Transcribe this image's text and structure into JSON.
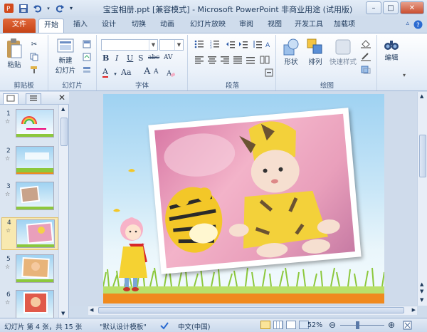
{
  "window": {
    "title": "宝宝相册.ppt [兼容模式] - Microsoft PowerPoint 非商业用途 (试用版)",
    "controls": [
      "–",
      "□",
      "✕"
    ]
  },
  "ribbon_tabs": [
    "文件",
    "开始",
    "插入",
    "设计",
    "切换",
    "动画",
    "幻灯片放映",
    "审阅",
    "视图",
    "开发工具",
    "加载项"
  ],
  "ribbon": {
    "clipboard": {
      "paste_label": "粘贴",
      "group_label": "剪贴板"
    },
    "slides": {
      "new_slide_label_1": "新建",
      "new_slide_label_2": "幻灯片",
      "group_label": "幻灯片"
    },
    "font": {
      "group_label": "字体",
      "bold": "B",
      "italic": "I",
      "underline": "U",
      "strike": "S",
      "abc": "abc",
      "av": "AV",
      "aa": "Aa",
      "grow": "A",
      "shrink": "A"
    },
    "paragraph": {
      "group_label": "段落"
    },
    "drawing": {
      "shapes_label": "形状",
      "arrange_label": "排列",
      "quick_styles_label": "快速样式",
      "group_label": "绘图"
    },
    "editing": {
      "label": "编辑"
    }
  },
  "slide_panel": {
    "slides": [
      {
        "num": "1",
        "star": "☆"
      },
      {
        "num": "2",
        "star": "☆"
      },
      {
        "num": "3",
        "star": "☆"
      },
      {
        "num": "4",
        "star": "☆"
      },
      {
        "num": "5",
        "star": "☆"
      },
      {
        "num": "6",
        "star": "☆"
      }
    ],
    "selected_index": 3
  },
  "status": {
    "slide_info": "幻灯片 第 4 张，共 15 张",
    "theme": "\"默认设计模板\"",
    "language": "中文(中国)",
    "zoom": "52%"
  },
  "colors": {
    "file_tab": "#c64416",
    "ribbon_bg": "#e9f0f9",
    "selected_thumb": "#f8e9b0",
    "grass": "#8cc83c",
    "ground": "#f08a1e"
  }
}
